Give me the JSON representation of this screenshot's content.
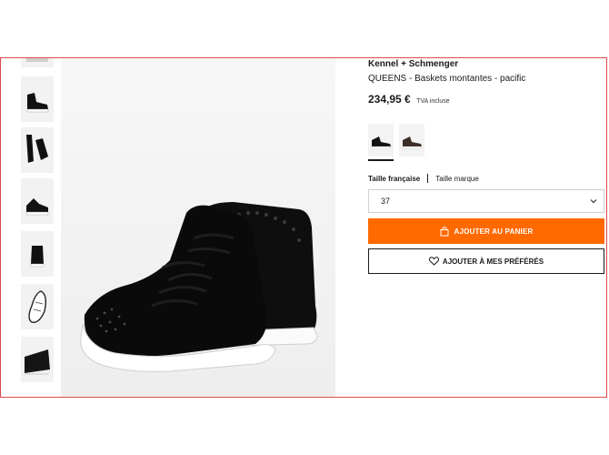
{
  "product": {
    "brand": "Kennel + Schmenger",
    "name": "QUEENS - Baskets montantes - pacific",
    "price": "234,95 €",
    "tax_note": "TVA incluse"
  },
  "colors": {
    "accent": "#ff6900",
    "frame_border": "#e0484c",
    "text": "#1a1a1a"
  },
  "gallery": {
    "thumbnails": [
      {
        "icon": "shoe-partial-icon"
      },
      {
        "icon": "shoe-side-icon"
      },
      {
        "icon": "shoe-pair-top-icon"
      },
      {
        "icon": "shoe-pair-front-icon"
      },
      {
        "icon": "shoe-back-icon"
      },
      {
        "icon": "shoe-sole-icon"
      },
      {
        "icon": "shoe-detail-icon"
      }
    ],
    "main_image": "black-high-top-sneaker-pair"
  },
  "swatches": [
    {
      "name": "black",
      "selected": true
    },
    {
      "name": "brown",
      "selected": false
    }
  ],
  "size": {
    "tab_french": "Taille française",
    "tab_brand": "Taille marque",
    "selected_value": "37"
  },
  "buttons": {
    "add_to_cart": "AJOUTER AU PANIER",
    "add_to_favorites": "AJOUTER À MES PRÉFÉRÉS"
  }
}
